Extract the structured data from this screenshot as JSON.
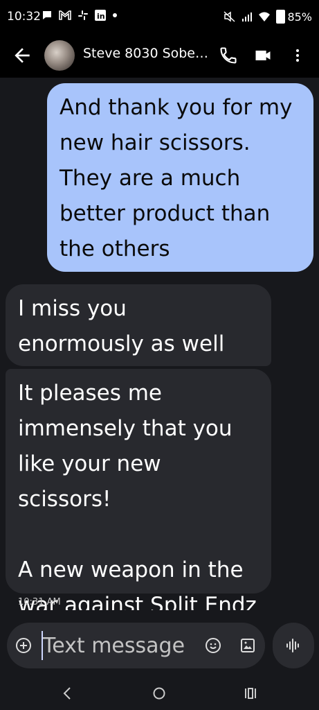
{
  "status_bar": {
    "time": "10:32",
    "notification_icons": [
      "chat-icon",
      "gmail-icon",
      "slack-icon",
      "linkedin-icon",
      "dot-icon"
    ],
    "battery": "85%"
  },
  "app_bar": {
    "contact_name": "Steve 8030 Sobe…"
  },
  "messages": [
    {
      "direction": "outgoing",
      "text": "And thank you for my new hair scissors. They are a much better product than the others"
    },
    {
      "direction": "incoming",
      "text": "I miss you enormously as well"
    },
    {
      "direction": "incoming",
      "text": "It pleases me immensely that you like your new scissors!\n\nA new weapon in the war against Split Endz"
    }
  ],
  "last_message_time": "10:31 AM",
  "compose": {
    "placeholder": "Text message"
  },
  "colors": {
    "outgoing_bubble": "#a8c4fb",
    "incoming_bubble": "#28292e",
    "background": "#17181c"
  }
}
